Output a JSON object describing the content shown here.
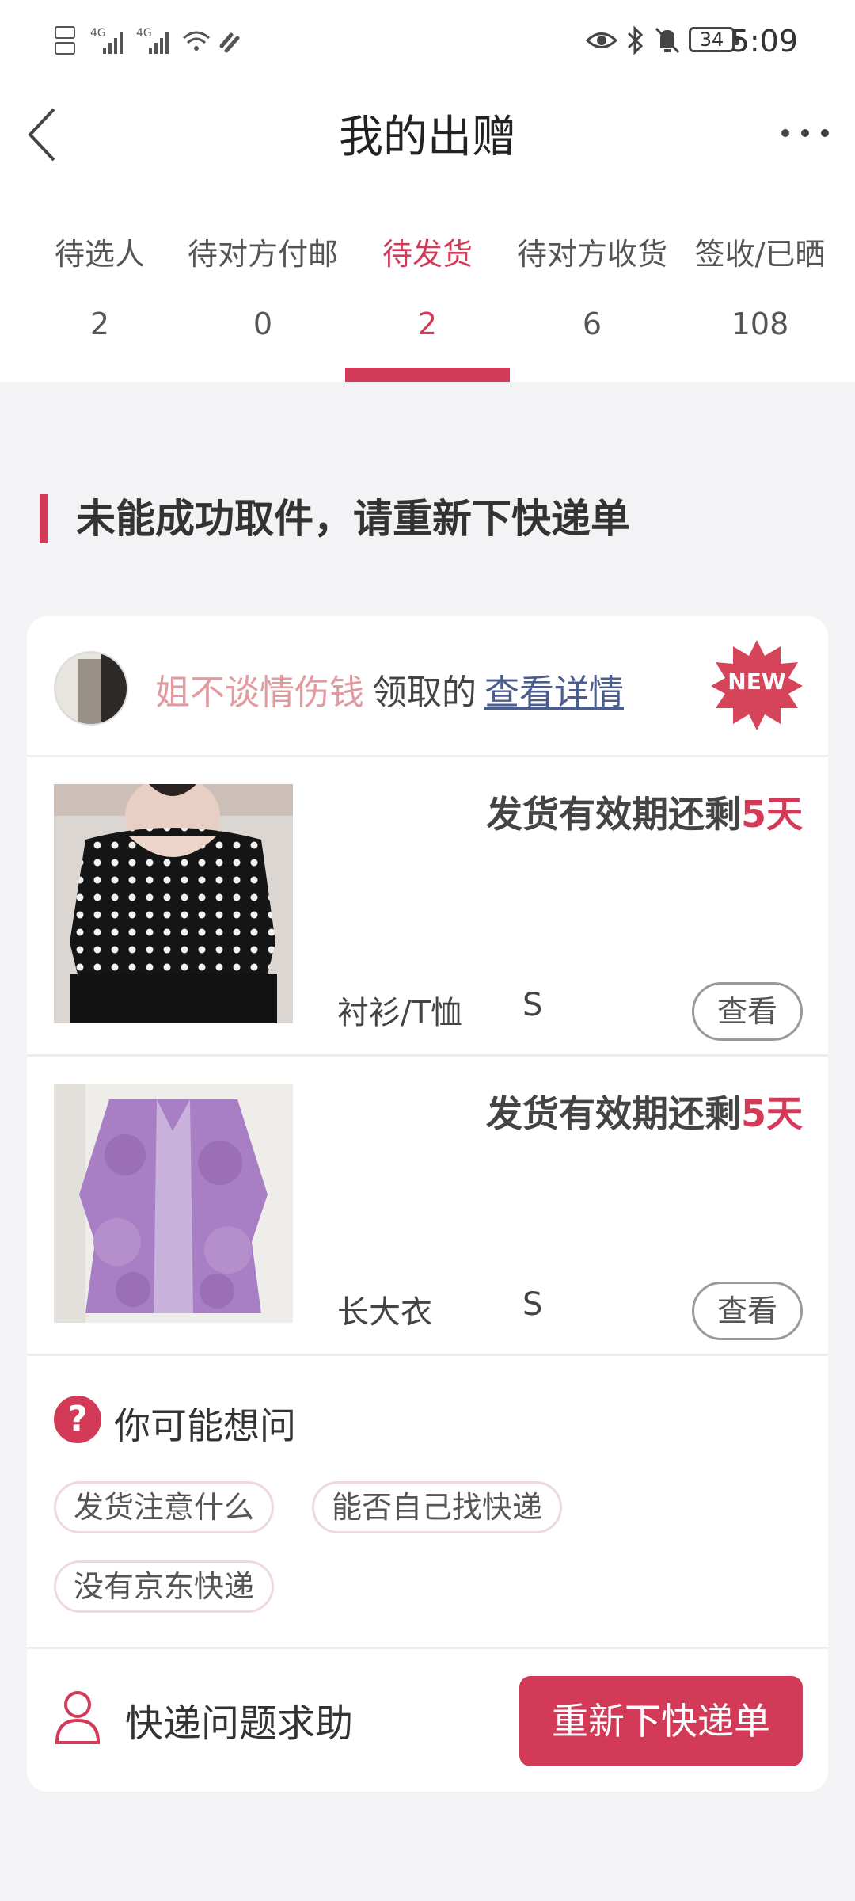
{
  "status_bar": {
    "network_left": "HD 4G 4G",
    "battery": "34",
    "time": "5:09"
  },
  "nav": {
    "title": "我的出赠"
  },
  "tabs": [
    {
      "label": "待选人",
      "count": "2"
    },
    {
      "label": "待对方付邮",
      "count": "0"
    },
    {
      "label": "待发货",
      "count": "2",
      "active": true
    },
    {
      "label": "待对方收货",
      "count": "6"
    },
    {
      "label": "签收/已晒",
      "count": "108"
    }
  ],
  "section_title": "未能成功取件，请重新下快递单",
  "card": {
    "receiver_name": "姐不谈情伤钱",
    "receiver_action": "领取的",
    "detail_link": "查看详情",
    "new_badge": "NEW",
    "items": [
      {
        "deadline_prefix": "发货有效期还剩",
        "deadline_days": "5天",
        "category": "衬衫/T恤",
        "size": "S",
        "view_label": "查看"
      },
      {
        "deadline_prefix": "发货有效期还剩",
        "deadline_days": "5天",
        "category": "长大衣",
        "size": "S",
        "view_label": "查看"
      }
    ],
    "faq": {
      "icon": "?",
      "title": "你可能想问",
      "chips": [
        "发货注意什么",
        "能否自己找快递",
        "没有京东快递"
      ]
    },
    "help": {
      "label": "快递问题求助",
      "button": "重新下快递单"
    }
  },
  "colors": {
    "accent": "#d23a58",
    "receiver_name": "#e29a9e",
    "link": "#4b5d8f",
    "background": "#f3f3f5"
  }
}
